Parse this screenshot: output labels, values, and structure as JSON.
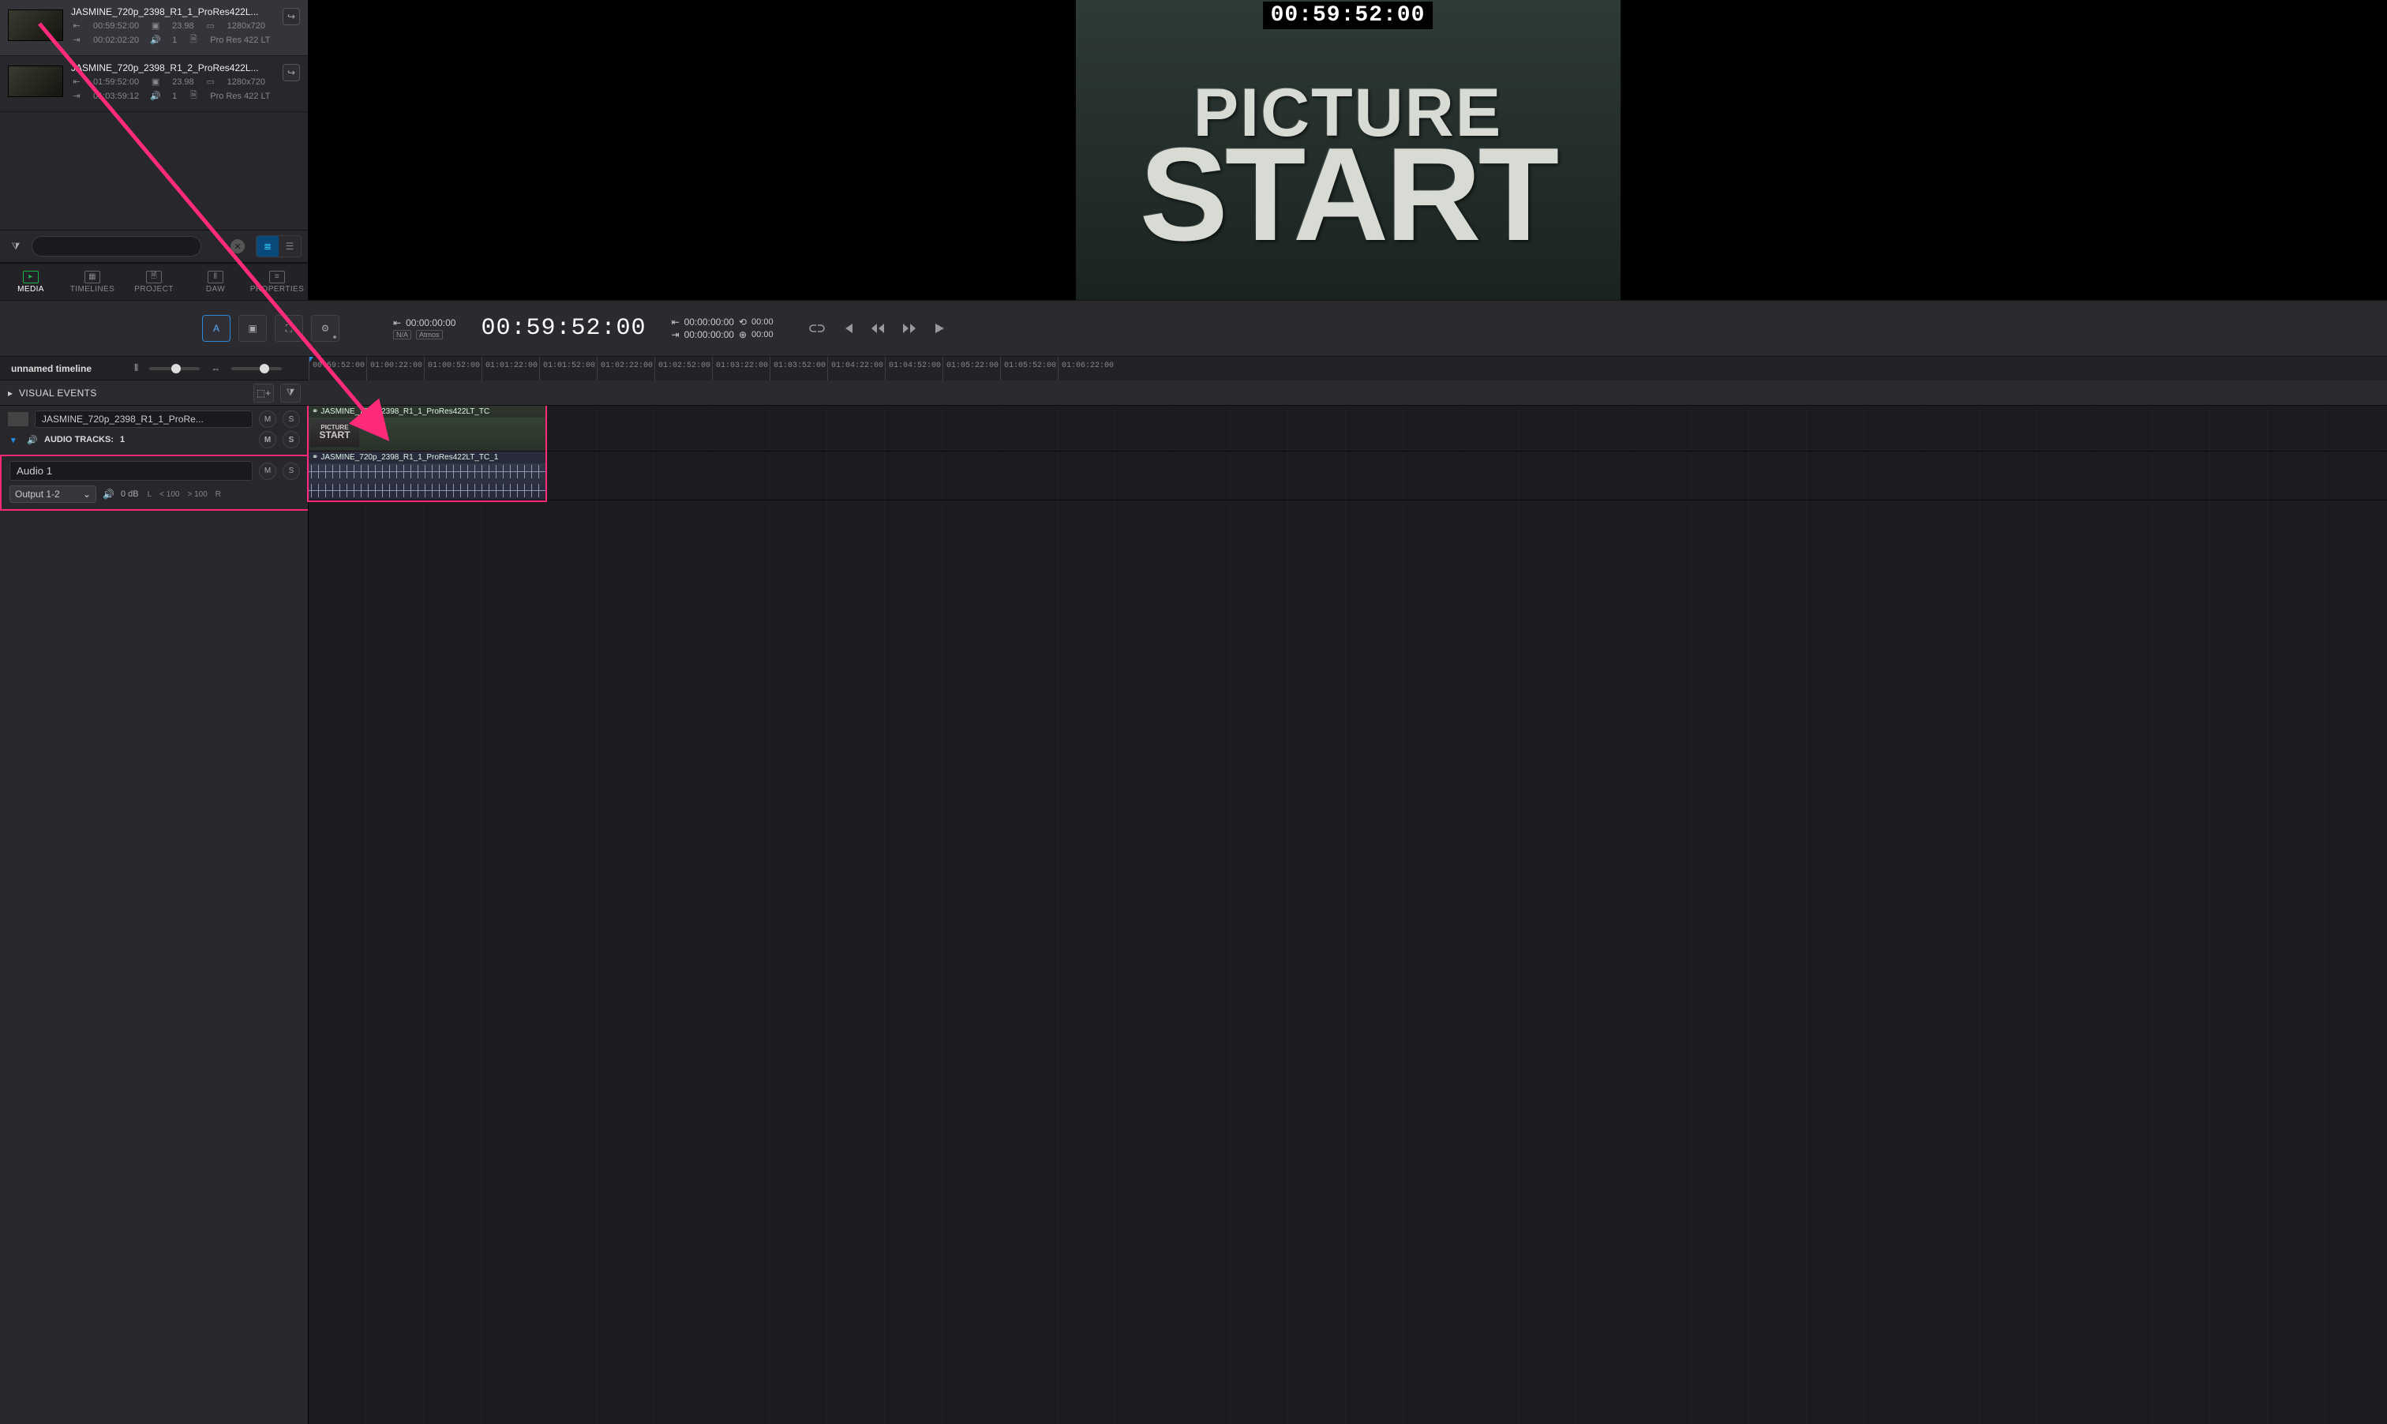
{
  "viewer": {
    "burn_in_tc": "00:59:52:00",
    "slate_line1": "PICTURE",
    "slate_line2": "START"
  },
  "clips": [
    {
      "name": "JASMINE_720p_2398_R1_1_ProRes422L...",
      "start_tc": "00:59:52:00",
      "fps": "23.98",
      "resolution": "1280x720",
      "duration": "00:02:02:20",
      "audio_ch": "1",
      "codec": "Pro Res 422 LT"
    },
    {
      "name": "JASMINE_720p_2398_R1_2_ProRes422L...",
      "start_tc": "01:59:52:00",
      "fps": "23.98",
      "resolution": "1280x720",
      "duration": "01:03:59:12",
      "audio_ch": "1",
      "codec": "Pro Res 422 LT"
    }
  ],
  "panel_tabs": {
    "media": "MEDIA",
    "timelines": "TIMELINES",
    "project": "PROJECT",
    "daw": "DAW",
    "properties": "PROPERTIES"
  },
  "transport": {
    "tool_a": "A",
    "in_tc": "00:00:00:00",
    "out_tc": "00:00:00:00",
    "na": "N/A",
    "atmos": "Atmos",
    "main_tc": "00:59:52:00",
    "r_in": "00:00:00:00",
    "r_out": "00:00:00:00",
    "dur1": "00:00",
    "dur2": "00:00"
  },
  "timeline": {
    "name": "unnamed timeline",
    "visual_events": "VISUAL EVENTS",
    "video_track_name": "JASMINE_720p_2398_R1_1_ProRe...",
    "audio_tracks_label": "AUDIO TRACKS:",
    "audio_tracks_count": "1",
    "audio1_name": "Audio 1",
    "output_sel": "Output 1-2",
    "db": "0 dB",
    "pan_l": "L",
    "pan_l_val": "< 100",
    "pan_r_val": "> 100",
    "pan_r": "R",
    "mute": "M",
    "solo": "S",
    "ruler_ticks": [
      "00:59:52:00",
      "01:00:22:00",
      "01:00:52:00",
      "01:01:22:00",
      "01:01:52:00",
      "01:02:22:00",
      "01:02:52:00",
      "01:03:22:00",
      "01:03:52:00",
      "01:04:22:00",
      "01:04:52:00",
      "01:05:22:00",
      "01:05:52:00",
      "01:06:22:00"
    ],
    "clip_v_label": "JASMINE_720p_2398_R1_1_ProRes422LT_TC",
    "clip_a_label": "JASMINE_720p_2398_R1_1_ProRes422LT_TC_1",
    "mini_line1": "PICTURE",
    "mini_line2": "START"
  },
  "search": {
    "placeholder": ""
  }
}
